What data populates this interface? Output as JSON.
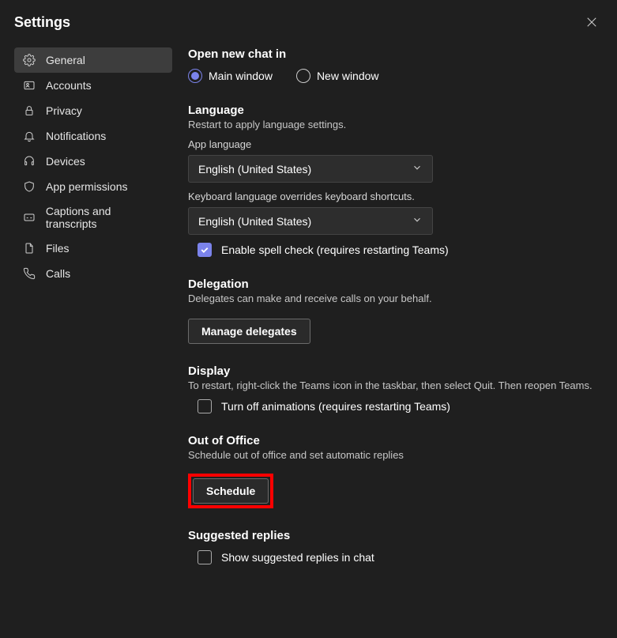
{
  "title": "Settings",
  "sidebar": {
    "items": [
      {
        "label": "General"
      },
      {
        "label": "Accounts"
      },
      {
        "label": "Privacy"
      },
      {
        "label": "Notifications"
      },
      {
        "label": "Devices"
      },
      {
        "label": "App permissions"
      },
      {
        "label": "Captions and transcripts"
      },
      {
        "label": "Files"
      },
      {
        "label": "Calls"
      }
    ]
  },
  "chat": {
    "title": "Open new chat in",
    "option_main": "Main window",
    "option_new": "New window",
    "selected": "main"
  },
  "language": {
    "title": "Language",
    "sub": "Restart to apply language settings.",
    "app_label": "App language",
    "app_value": "English (United States)",
    "keyboard_label": "Keyboard language overrides keyboard shortcuts.",
    "keyboard_value": "English (United States)",
    "spellcheck_label": "Enable spell check (requires restarting Teams)",
    "spellcheck_checked": true
  },
  "delegation": {
    "title": "Delegation",
    "sub": "Delegates can make and receive calls on your behalf.",
    "button": "Manage delegates"
  },
  "display": {
    "title": "Display",
    "sub": "To restart, right-click the Teams icon in the taskbar, then select Quit. Then reopen Teams.",
    "animations_label": "Turn off animations (requires restarting Teams)",
    "animations_checked": false
  },
  "ooo": {
    "title": "Out of Office",
    "sub": "Schedule out of office and set automatic replies",
    "button": "Schedule"
  },
  "suggested": {
    "title": "Suggested replies",
    "label": "Show suggested replies in chat",
    "checked": false
  }
}
